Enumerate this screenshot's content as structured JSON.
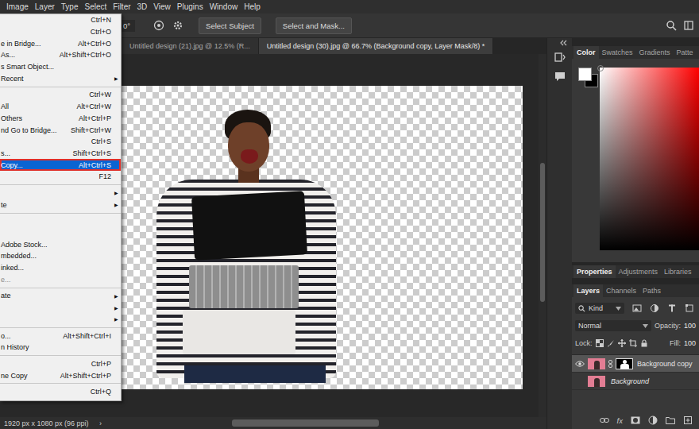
{
  "menu_bar": {
    "items": [
      "Image",
      "Layer",
      "Type",
      "Select",
      "Filter",
      "3D",
      "View",
      "Plugins",
      "Window",
      "Help"
    ]
  },
  "file_menu": {
    "items": [
      {
        "kind": "item",
        "label": "",
        "shortcut": "Ctrl+N",
        "arrow": "",
        "disabled": false,
        "selected": false
      },
      {
        "kind": "item",
        "label": "",
        "shortcut": "Ctrl+O",
        "arrow": "",
        "disabled": false,
        "selected": false
      },
      {
        "kind": "item",
        "label": "e in Bridge...",
        "shortcut": "Alt+Ctrl+O",
        "arrow": "",
        "disabled": false,
        "selected": false
      },
      {
        "kind": "item",
        "label": "As...",
        "shortcut": "Alt+Shift+Ctrl+O",
        "arrow": "",
        "disabled": false,
        "selected": false
      },
      {
        "kind": "item",
        "label": "s Smart Object...",
        "shortcut": "",
        "arrow": "",
        "disabled": false,
        "selected": false
      },
      {
        "kind": "item",
        "label": "Recent",
        "shortcut": "",
        "arrow": "▶",
        "disabled": false,
        "selected": false
      },
      {
        "kind": "separator"
      },
      {
        "kind": "item",
        "label": "",
        "shortcut": "Ctrl+W",
        "arrow": "",
        "disabled": false,
        "selected": false
      },
      {
        "kind": "item",
        "label": "All",
        "shortcut": "Alt+Ctrl+W",
        "arrow": "",
        "disabled": false,
        "selected": false
      },
      {
        "kind": "item",
        "label": "Others",
        "shortcut": "Alt+Ctrl+P",
        "arrow": "",
        "disabled": false,
        "selected": false
      },
      {
        "kind": "item",
        "label": "nd Go to Bridge...",
        "shortcut": "Shift+Ctrl+W",
        "arrow": "",
        "disabled": false,
        "selected": false
      },
      {
        "kind": "item",
        "label": "",
        "shortcut": "Ctrl+S",
        "arrow": "",
        "disabled": false,
        "selected": false
      },
      {
        "kind": "item",
        "label": "s...",
        "shortcut": "Shift+Ctrl+S",
        "arrow": "",
        "disabled": false,
        "selected": false
      },
      {
        "kind": "item",
        "label": "Copy...",
        "shortcut": "Alt+Ctrl+S",
        "arrow": "",
        "disabled": false,
        "selected": true
      },
      {
        "kind": "item",
        "label": "",
        "shortcut": "F12",
        "arrow": "",
        "disabled": false,
        "selected": false
      },
      {
        "kind": "separator"
      },
      {
        "kind": "item",
        "label": "",
        "shortcut": "",
        "arrow": "▶",
        "disabled": false,
        "selected": false
      },
      {
        "kind": "item",
        "label": "te",
        "shortcut": "",
        "arrow": "▶",
        "disabled": false,
        "selected": false
      },
      {
        "kind": "separator"
      },
      {
        "kind": "item",
        "label": "",
        "shortcut": "",
        "arrow": "",
        "disabled": false,
        "selected": false
      },
      {
        "kind": "item",
        "label": "",
        "shortcut": "",
        "arrow": "",
        "disabled": false,
        "selected": false
      },
      {
        "kind": "item",
        "label": "Adobe Stock...",
        "shortcut": "",
        "arrow": "",
        "disabled": false,
        "selected": false
      },
      {
        "kind": "item",
        "label": "mbedded...",
        "shortcut": "",
        "arrow": "",
        "disabled": false,
        "selected": false
      },
      {
        "kind": "item",
        "label": "inked...",
        "shortcut": "",
        "arrow": "",
        "disabled": false,
        "selected": false
      },
      {
        "kind": "item",
        "label": "e...",
        "shortcut": "",
        "arrow": "",
        "disabled": true,
        "selected": false
      },
      {
        "kind": "separator"
      },
      {
        "kind": "item",
        "label": "ate",
        "shortcut": "",
        "arrow": "▶",
        "disabled": false,
        "selected": false
      },
      {
        "kind": "item",
        "label": "",
        "shortcut": "",
        "arrow": "▶",
        "disabled": false,
        "selected": false
      },
      {
        "kind": "item",
        "label": "",
        "shortcut": "",
        "arrow": "▶",
        "disabled": false,
        "selected": false
      },
      {
        "kind": "separator"
      },
      {
        "kind": "item",
        "label": "o...",
        "shortcut": "Alt+Shift+Ctrl+I",
        "arrow": "",
        "disabled": false,
        "selected": false
      },
      {
        "kind": "item",
        "label": "n History",
        "shortcut": "",
        "arrow": "",
        "disabled": false,
        "selected": false
      },
      {
        "kind": "separator"
      },
      {
        "kind": "item",
        "label": "",
        "shortcut": "Ctrl+P",
        "arrow": "",
        "disabled": false,
        "selected": false
      },
      {
        "kind": "item",
        "label": "ne Copy",
        "shortcut": "Alt+Shift+Ctrl+P",
        "arrow": "",
        "disabled": false,
        "selected": false
      },
      {
        "kind": "separator"
      },
      {
        "kind": "item",
        "label": "",
        "shortcut": "Ctrl+Q",
        "arrow": "",
        "disabled": false,
        "selected": false
      }
    ]
  },
  "options_bar": {
    "angle": "0°",
    "buttons": [
      "Select Subject",
      "Select and Mask..."
    ]
  },
  "document_tabs": [
    {
      "label": "Untitled design (21).jpg @ 12.5% (R...",
      "selected": false
    },
    {
      "label": "Untitled design (30).jpg @ 66.7% (Background copy, Layer Mask/8) *",
      "selected": true
    }
  ],
  "status_bar": {
    "text": "1920 px x 1080 px (96 ppi)",
    "arrow": "›"
  },
  "color_panel": {
    "tabs": [
      {
        "label": "Color",
        "selected": true
      },
      {
        "label": "Swatches",
        "selected": false
      },
      {
        "label": "Gradients",
        "selected": false
      },
      {
        "label": "Patte",
        "selected": false
      }
    ]
  },
  "properties_panel": {
    "tabs": [
      {
        "label": "Properties",
        "selected": true
      },
      {
        "label": "Adjustments",
        "selected": false
      },
      {
        "label": "Libraries",
        "selected": false
      }
    ]
  },
  "layers_panel": {
    "tabs": [
      {
        "label": "Layers",
        "selected": true
      },
      {
        "label": "Channels",
        "selected": false
      },
      {
        "label": "Paths",
        "selected": false
      }
    ],
    "filter": "Kind",
    "blend_mode": "Normal",
    "opacity_label": "Opacity:",
    "opacity": "100",
    "lock_label": "Lock:",
    "fill_label": "Fill:",
    "fill": "100",
    "layers": [
      {
        "name": "Background copy",
        "visible": true,
        "selected": true,
        "mask": true,
        "italic": false
      },
      {
        "name": "Background",
        "visible": false,
        "selected": false,
        "mask": false,
        "italic": true
      }
    ],
    "footer_text": "fx"
  }
}
